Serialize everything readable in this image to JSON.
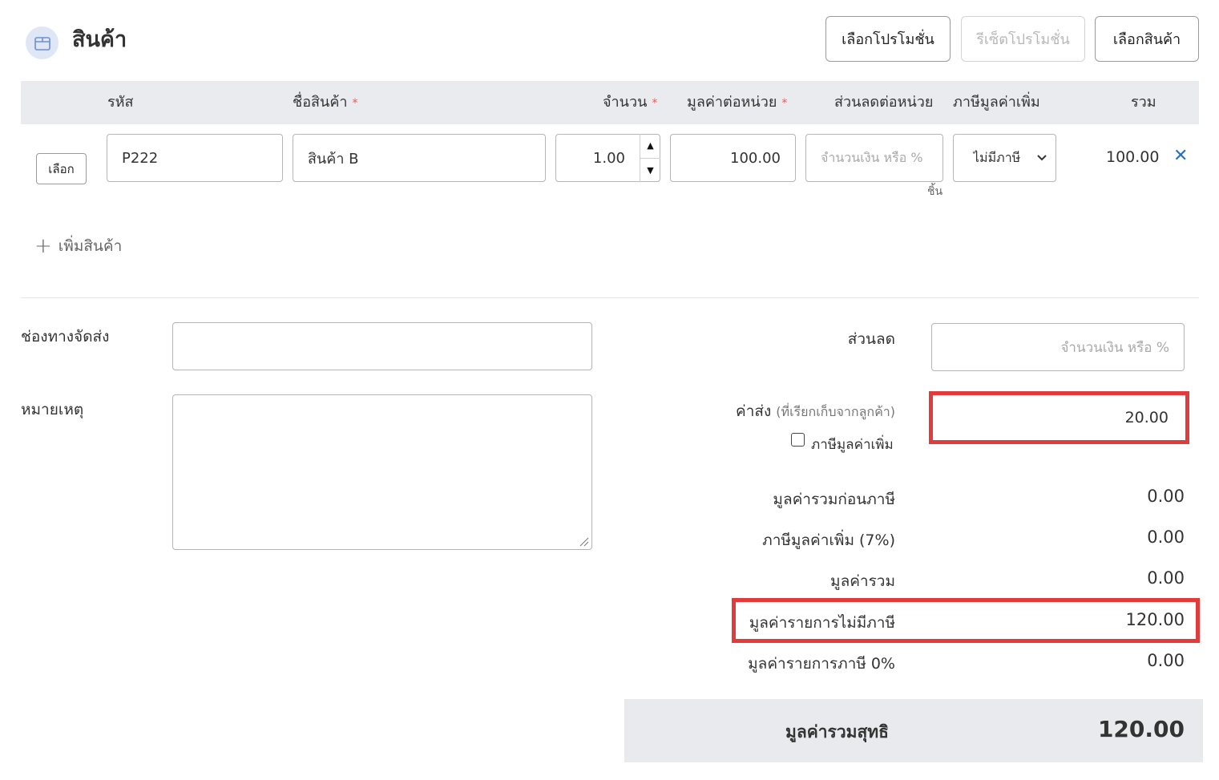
{
  "header": {
    "title": "สินค้า",
    "icon": "package-icon",
    "buttons": {
      "select_promotion": "เลือกโปรโมชั่น",
      "reset_promotion": "รีเซ็ตโปรโมชั่น",
      "select_product": "เลือกสินค้า"
    }
  },
  "table": {
    "columns": {
      "code": "รหัส",
      "name": "ชื่อสินค้า",
      "quantity": "จำนวน",
      "unit_price": "มูลค่าต่อหน่วย",
      "discount": "ส่วนลดต่อหน่วย",
      "vat": "ภาษีมูลค่าเพิ่ม",
      "total": "รวม"
    },
    "required_mark": "*",
    "rows": [
      {
        "select_label": "เลือก",
        "code": "P222",
        "name": "สินค้า B",
        "quantity": "1.00",
        "unit_price": "100.00",
        "discount_placeholder": "จำนวนเงิน หรือ %",
        "unit": "ชิ้น",
        "vat": "ไม่มีภาษี",
        "total": "100.00"
      }
    ],
    "add_item_label": "เพิ่มสินค้า"
  },
  "left_form": {
    "shipping_channel_label": "ช่องทางจัดส่ง",
    "shipping_channel_value": "",
    "note_label": "หมายเหตุ",
    "note_value": ""
  },
  "summary": {
    "discount_label": "ส่วนลด",
    "discount_placeholder": "จำนวนเงิน หรือ %",
    "shipping_label": "ค่าส่ง",
    "shipping_sub_label": "(ที่เรียกเก็บจากลูกค้า)",
    "shipping_value": "20.00",
    "shipping_vat_label": "ภาษีมูลค่าเพิ่ม",
    "shipping_vat_checked": false,
    "lines": [
      {
        "label": "มูลค่ารวมก่อนภาษี",
        "value": "0.00"
      },
      {
        "label": "ภาษีมูลค่าเพิ่ม (7%)",
        "value": "0.00"
      },
      {
        "label": "มูลค่ารวม",
        "value": "0.00"
      },
      {
        "label": "มูลค่ารายการไม่มีภาษี",
        "value": "120.00"
      },
      {
        "label": "มูลค่ารายการภาษี 0%",
        "value": "0.00"
      }
    ],
    "grand_total_label": "มูลค่ารวมสุทธิ",
    "grand_total_value": "120.00"
  },
  "colors": {
    "highlight": "#e23b3b",
    "header_bg": "#e9ebee",
    "link": "#2a6fbf",
    "icon_bg": "#dfe7f7"
  }
}
